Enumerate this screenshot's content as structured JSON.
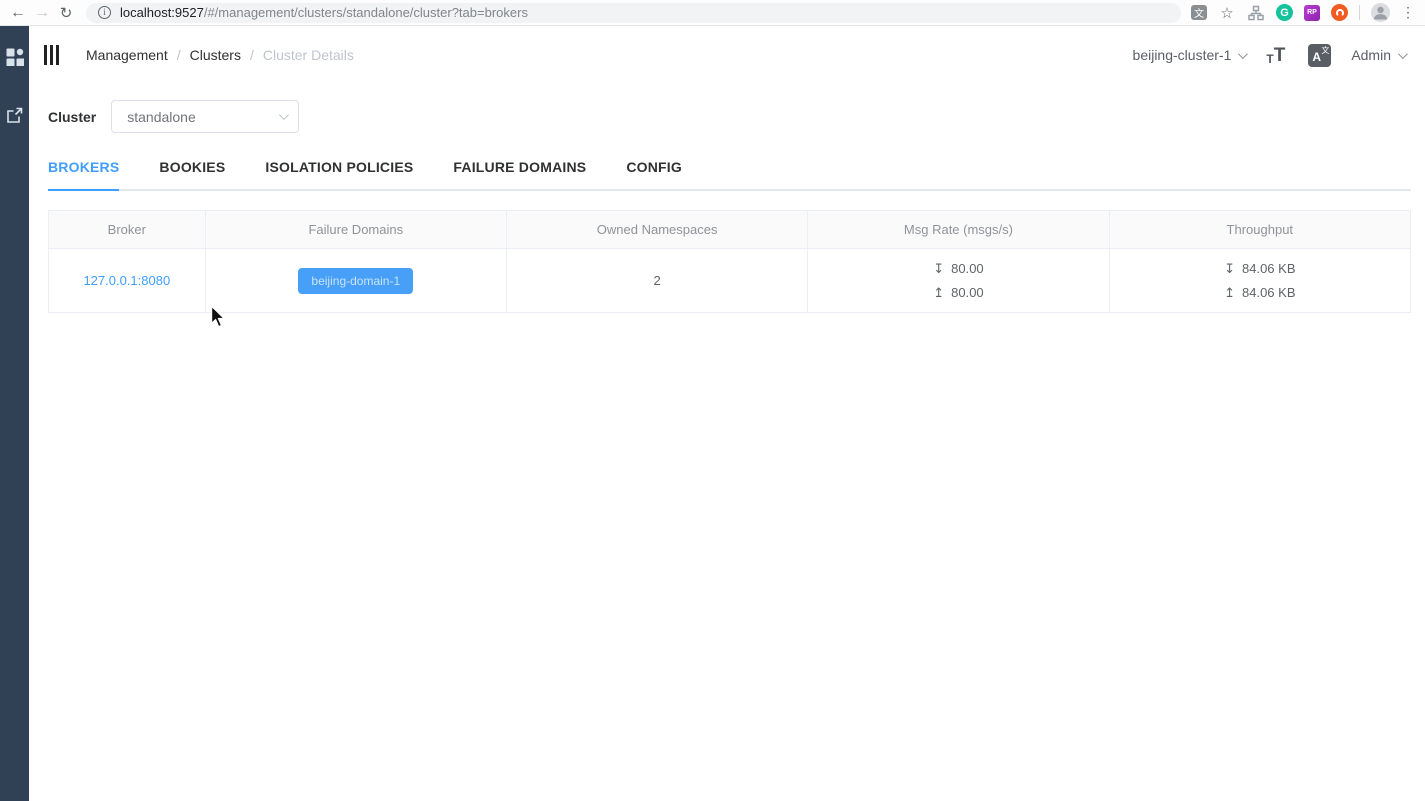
{
  "browser": {
    "url_host": "localhost:9527",
    "url_path": "/#/management/clusters/standalone/cluster?tab=brokers"
  },
  "header": {
    "breadcrumb": {
      "separator": "/",
      "items": [
        {
          "label": "Management"
        },
        {
          "label": "Clusters"
        },
        {
          "label": "Cluster Details"
        }
      ]
    },
    "cluster_dropdown_value": "beijing-cluster-1",
    "user_dropdown_value": "Admin"
  },
  "toolbar": {
    "cluster_label": "Cluster",
    "cluster_select_value": "standalone"
  },
  "tabs": [
    {
      "label": "BROKERS",
      "active": true
    },
    {
      "label": "BOOKIES",
      "active": false
    },
    {
      "label": "ISOLATION POLICIES",
      "active": false
    },
    {
      "label": "FAILURE DOMAINS",
      "active": false
    },
    {
      "label": "CONFIG",
      "active": false
    }
  ],
  "brokers_table": {
    "columns": [
      "Broker",
      "Failure Domains",
      "Owned Namespaces",
      "Msg Rate (msgs/s)",
      "Throughput"
    ],
    "rows": [
      {
        "broker": "127.0.0.1:8080",
        "failure_domains": [
          "beijing-domain-1"
        ],
        "owned_namespaces": "2",
        "msg_rate_in": "80.00",
        "msg_rate_out": "80.00",
        "throughput_in": "84.06 KB",
        "throughput_out": "84.06 KB"
      }
    ]
  },
  "icons": {
    "back": "←",
    "forward": "→",
    "reload": "↻",
    "info": "i",
    "bookmark_star": "☆",
    "kebab": "⋮",
    "grammarly_g": "G",
    "rp_badge": "RP",
    "translate_char": "文",
    "font_small_t": "T",
    "font_large_t": "T",
    "lang_a": "A",
    "lang_zh": "文",
    "arrow_in": "↧",
    "arrow_out": "↥"
  },
  "colors": {
    "accent": "#409eff",
    "sidebar_bg": "#304156",
    "tag_bg": "#479ff7",
    "table_border": "#ebeef5",
    "breadcrumb_muted": "#c0c4cc"
  }
}
